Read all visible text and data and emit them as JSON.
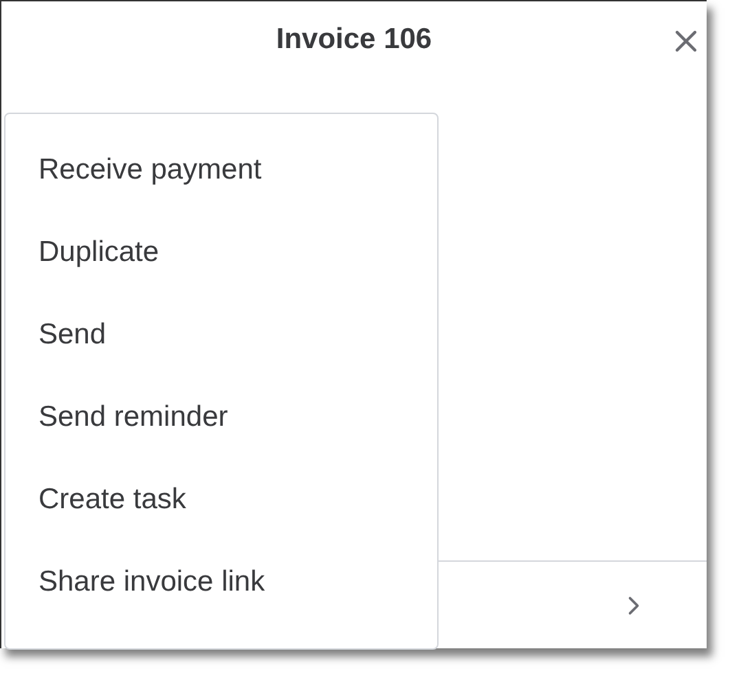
{
  "header": {
    "title": "Invoice 106"
  },
  "menu": {
    "items": [
      {
        "label": "Receive payment"
      },
      {
        "label": "Duplicate"
      },
      {
        "label": "Send"
      },
      {
        "label": "Send reminder"
      },
      {
        "label": "Create task"
      },
      {
        "label": "Share invoice link"
      }
    ]
  }
}
